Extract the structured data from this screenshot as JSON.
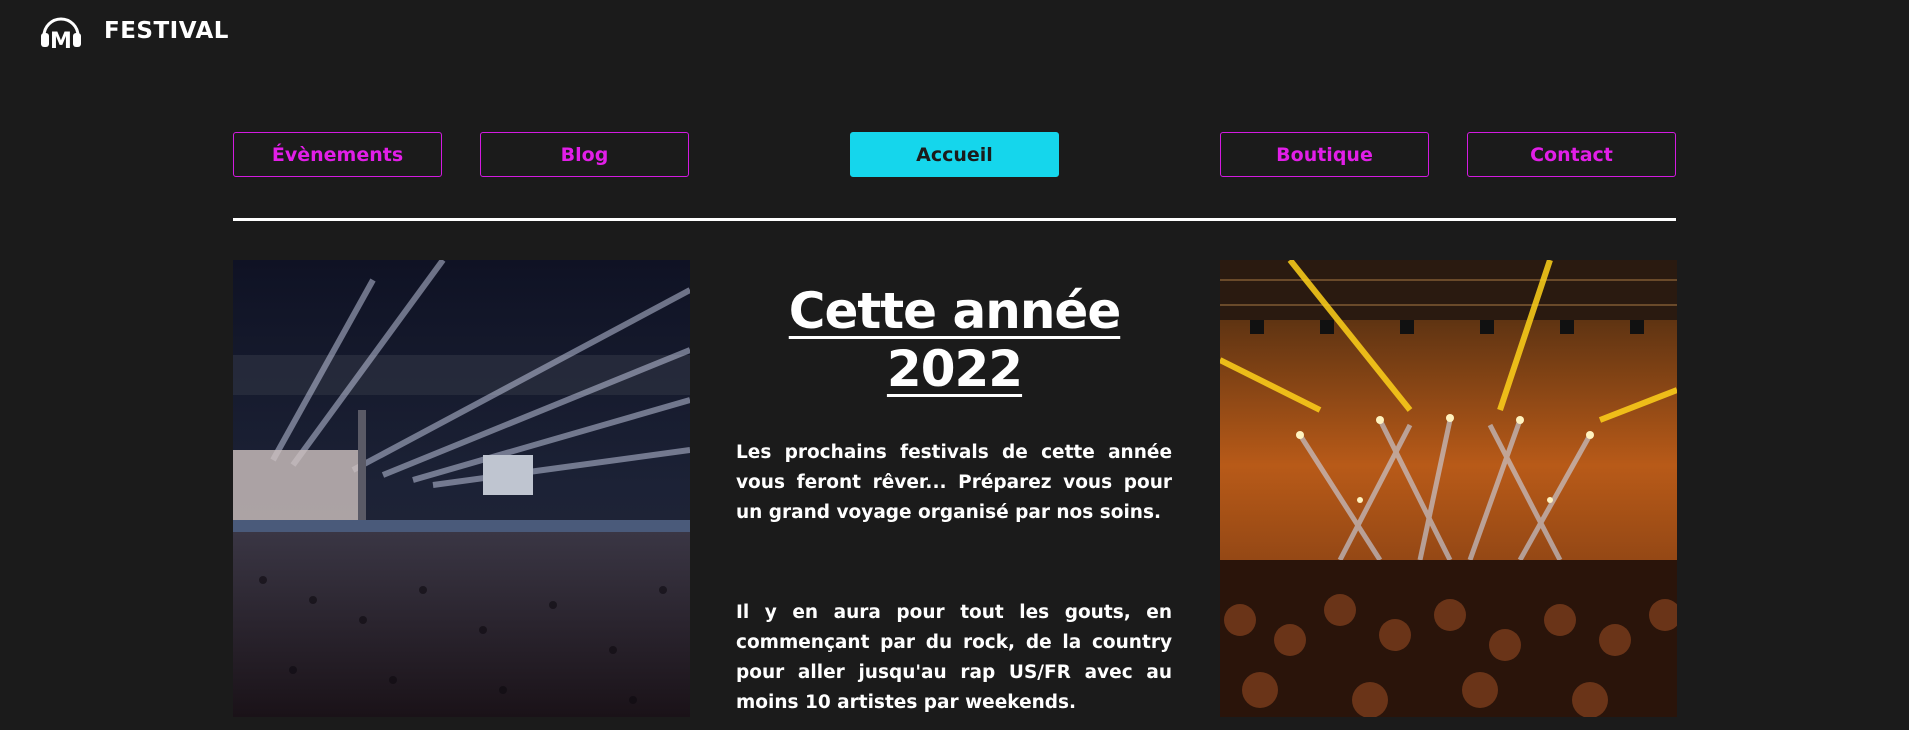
{
  "header": {
    "logo_icon": "headphones-m-logo-icon",
    "brand": "FESTIVAL"
  },
  "nav": {
    "items": [
      {
        "label": "Évènements",
        "active": false
      },
      {
        "label": "Blog",
        "active": false
      },
      {
        "label": "Accueil",
        "active": true
      },
      {
        "label": "Boutique",
        "active": false
      },
      {
        "label": "Contact",
        "active": false
      }
    ]
  },
  "main": {
    "headline": "Cette année 2022",
    "paragraphs": [
      "Les prochains festivals de cette année vous feront rêver... Préparez vous pour un grand voyage organisé par nos soins.",
      "Il y en aura pour tout les gouts, en commençant par du rock, de la country pour aller jusqu'au rap US/FR avec au moins 10 artistes par weekends."
    ],
    "images": {
      "left": "concert-stadium-photo",
      "right": "concert-stage-lights-photo"
    }
  },
  "colors": {
    "background": "#1b1b1b",
    "nav_border": "#d31be0",
    "nav_text": "#e21ee8",
    "active_bg": "#15d6ec"
  }
}
